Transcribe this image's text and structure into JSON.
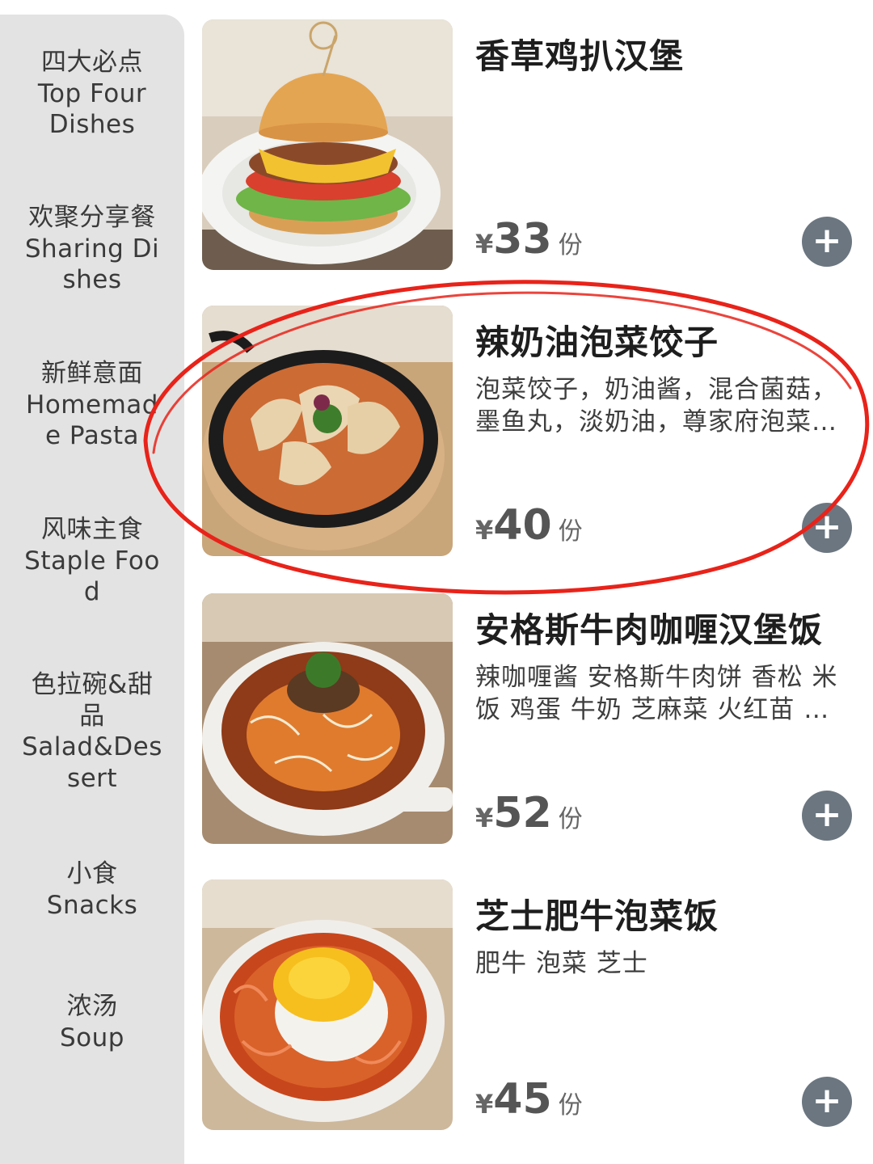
{
  "sidebar": {
    "categories": [
      {
        "zh": "四大必点",
        "en_lines": [
          "Top Four",
          "Dishes"
        ]
      },
      {
        "zh": "欢聚分享餐",
        "en_lines": [
          "Sharing Di",
          "shes"
        ]
      },
      {
        "zh": "新鲜意面",
        "en_lines": [
          "Homemad",
          "e Pasta"
        ]
      },
      {
        "zh": "风味主食",
        "en_lines": [
          "Staple Foo",
          "d"
        ]
      },
      {
        "zh": "色拉碗&甜",
        "zh2": "品",
        "en_lines": [
          "Salad&Des",
          "sert"
        ]
      },
      {
        "zh": "小食",
        "en_lines": [
          "Snacks"
        ]
      },
      {
        "zh": "浓汤",
        "en_lines": [
          "Soup"
        ]
      }
    ]
  },
  "products": [
    {
      "name": "香草鸡扒汉堡",
      "desc_lines": [],
      "currency": "¥",
      "price": "33",
      "unit": "份",
      "add_icon": "plus-icon"
    },
    {
      "name": "辣奶油泡菜饺子",
      "desc_lines": [
        "泡菜饺子，奶油酱，混合菌菇，",
        "墨鱼丸，淡奶油，尊家府泡菜…"
      ],
      "currency": "¥",
      "price": "40",
      "unit": "份",
      "add_icon": "plus-icon"
    },
    {
      "name": "安格斯牛肉咖喱汉堡饭",
      "desc_lines": [
        "辣咖喱酱 安格斯牛肉饼 香松 米",
        "饭 鸡蛋 牛奶 芝麻菜 火红苗 …"
      ],
      "currency": "¥",
      "price": "52",
      "unit": "份",
      "add_icon": "plus-icon"
    },
    {
      "name": "芝士肥牛泡菜饭",
      "desc_lines": [
        "肥牛 泡菜 芝士"
      ],
      "currency": "¥",
      "price": "45",
      "unit": "份",
      "add_icon": "plus-icon"
    }
  ],
  "colors": {
    "sidebar_bg": "#e3e3e3",
    "add_button": "#6b7680",
    "annotation_circle": "#e8231a"
  }
}
